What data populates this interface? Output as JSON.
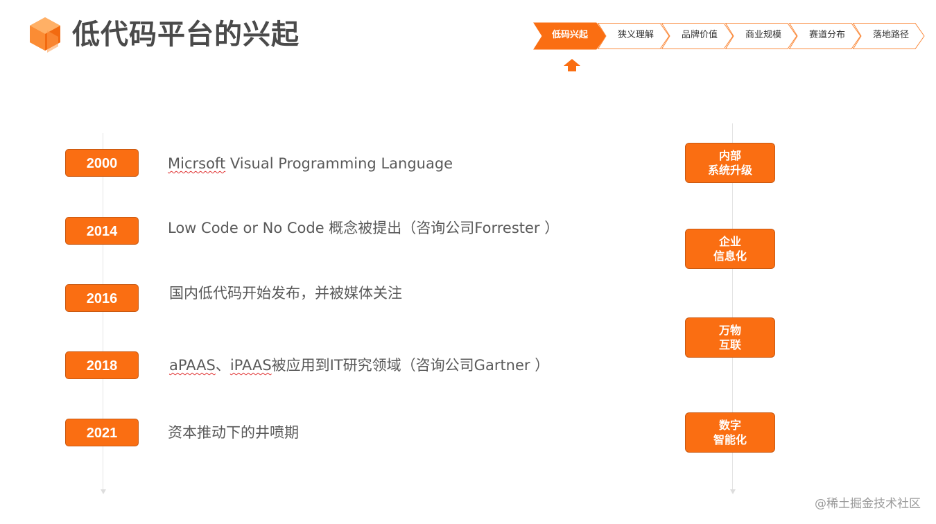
{
  "header": {
    "title": "低代码平台的兴起"
  },
  "nav": {
    "items": [
      {
        "label": "低码兴起",
        "active": true
      },
      {
        "label": "狭义理解",
        "active": false
      },
      {
        "label": "品牌价值",
        "active": false
      },
      {
        "label": "商业规模",
        "active": false
      },
      {
        "label": "赛道分布",
        "active": false
      },
      {
        "label": "落地路径",
        "active": false
      }
    ]
  },
  "timeline": {
    "events": [
      {
        "year": "2000",
        "text_marked": "Micrsoft",
        "text": " Visual Programming Language"
      },
      {
        "year": "2014",
        "text_marked": "",
        "text": "Low Code or No Code 概念被提出（咨询公司Forrester ）"
      },
      {
        "year": "2016",
        "text_marked": "",
        "text": "国内低代码开始发布，并被媒体关注"
      },
      {
        "year": "2018",
        "text_marked": "aPAAS",
        "text_sep": "、",
        "text_marked2": "iPAAS",
        "text": "被应用到IT研究领域（咨询公司Gartner ）"
      },
      {
        "year": "2021",
        "text_marked": "",
        "text": "资本推动下的井喷期"
      }
    ]
  },
  "stages": [
    {
      "line1": "内部",
      "line2": "系统升级"
    },
    {
      "line1": "企业",
      "line2": "信息化"
    },
    {
      "line1": "万物",
      "line2": "互联"
    },
    {
      "line1": "数字",
      "line2": "智能化"
    }
  ],
  "watermark": "@稀土掘金技术社区",
  "colors": {
    "accent": "#fa6e12",
    "accent_border": "#c85810",
    "text": "#595959",
    "title": "#4a4a4a"
  },
  "icons": {
    "logo": "orange-cube-logo-icon",
    "active_indicator": "up-arrow-icon"
  }
}
